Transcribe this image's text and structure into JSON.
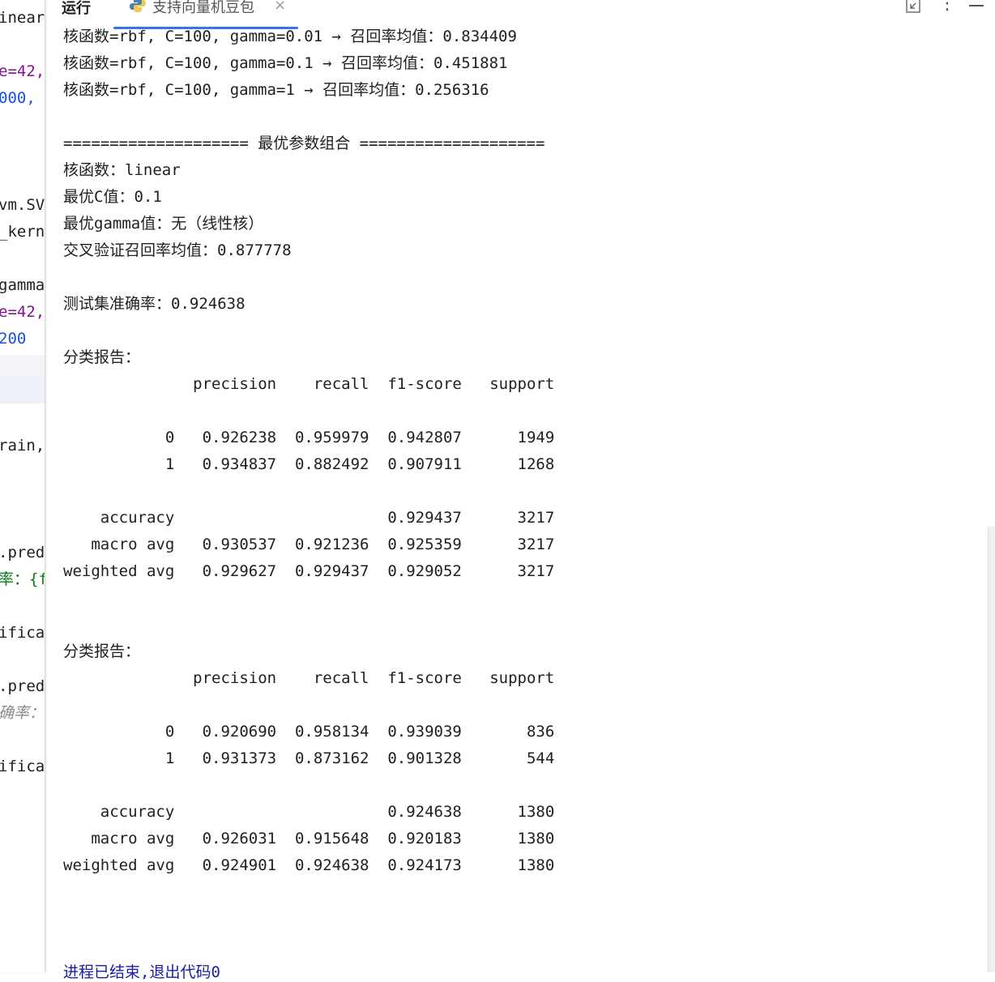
{
  "editor": {
    "fragments": [
      {
        "text": "inear",
        "cls": "c-default"
      },
      {
        "text": "e=42,",
        "cls": "c-param"
      },
      {
        "text": "000,",
        "cls": "c-num"
      },
      {
        "text": "vm.SV",
        "cls": "c-default"
      },
      {
        "text": "_kern",
        "cls": "c-default"
      },
      {
        "text": "gamma",
        "cls": "c-default"
      },
      {
        "text": "e=42,",
        "cls": "c-param"
      },
      {
        "text": "200",
        "cls": "c-num"
      },
      {
        "text": "rain,",
        "cls": "c-default"
      },
      {
        "text": ".pred",
        "cls": "c-default"
      },
      {
        "text": "率：{fi",
        "cls": "c-green"
      },
      {
        "text": "ifica",
        "cls": "c-default"
      },
      {
        "text": ".pred",
        "cls": "c-default"
      },
      {
        "text": "确率：",
        "cls": "c-comment"
      },
      {
        "text": "ifica",
        "cls": "c-default"
      }
    ]
  },
  "toolwindow": {
    "title": "运行",
    "tab_label": "支持向量机豆包",
    "close_symbol": "×",
    "more_symbol": "⋮"
  },
  "console": {
    "lines": [
      "核函数=rbf, C=100, gamma=0.01 → 召回率均值：0.834409",
      "核函数=rbf, C=100, gamma=0.1 → 召回率均值：0.451881",
      "核函数=rbf, C=100, gamma=1 → 召回率均值：0.256316",
      "",
      "==================== 最优参数组合 ====================",
      "核函数：linear",
      "最优C值：0.1",
      "最优gamma值：无（线性核）",
      "交叉验证召回率均值：0.877778",
      "",
      "测试集准确率：0.924638",
      "",
      "分类报告：",
      "              precision    recall  f1-score   support",
      "",
      "           0   0.926238  0.959979  0.942807      1949",
      "           1   0.934837  0.882492  0.907911      1268",
      "",
      "    accuracy                       0.929437      3217",
      "   macro avg   0.930537  0.921236  0.925359      3217",
      "weighted avg   0.929627  0.929437  0.929052      3217",
      "",
      "",
      "分类报告：",
      "              precision    recall  f1-score   support",
      "",
      "           0   0.920690  0.958134  0.939039       836",
      "           1   0.931373  0.873162  0.901328       544",
      "",
      "    accuracy                       0.924638      1380",
      "   macro avg   0.926031  0.915648  0.920183      1380",
      "weighted avg   0.924901  0.924638  0.924173      1380",
      "",
      "",
      "",
      "进程已结束,退出代码0"
    ]
  }
}
